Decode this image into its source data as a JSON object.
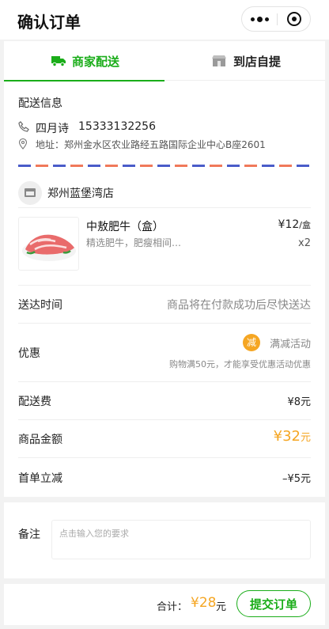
{
  "header": {
    "title": "确认订单"
  },
  "tabs": [
    {
      "label": "商家配送",
      "active": true,
      "icon": "truck-icon"
    },
    {
      "label": "到店自提",
      "active": false,
      "icon": "store-icon"
    }
  ],
  "delivery": {
    "section_title": "配送信息",
    "name": "四月诗",
    "phone": "15333132256",
    "address": "地址：郑州金水区农业路经五路国际企业中心B座2601"
  },
  "shop": {
    "name": "郑州蓝堡湾店"
  },
  "product": {
    "name": "中敖肥牛（盒）",
    "desc": "精选肥牛，肥瘦相间…",
    "price": "¥12",
    "price_unit": "/盒",
    "qty": "x2"
  },
  "rows": {
    "time_label": "送达时间",
    "time_value": "商品将在付款成功后尽快送达",
    "discount_label": "优惠",
    "discount_badge": "减",
    "discount_promo": "满减活动",
    "discount_note": "购物满50元，才能享受优惠活动优惠",
    "fee_label": "配送费",
    "fee_value": "¥8元",
    "amount_label": "商品金额",
    "amount_value": "¥32",
    "amount_unit": "元",
    "first_label": "首单立减",
    "first_value": "–¥5元"
  },
  "remark": {
    "label": "备注",
    "placeholder": "点击输入您的要求"
  },
  "footer": {
    "total_label": "合计：",
    "total_value": "¥28",
    "total_unit": "元",
    "submit_label": "提交订单"
  },
  "colors": {
    "accent": "#1aad19",
    "price": "#f5a623"
  }
}
